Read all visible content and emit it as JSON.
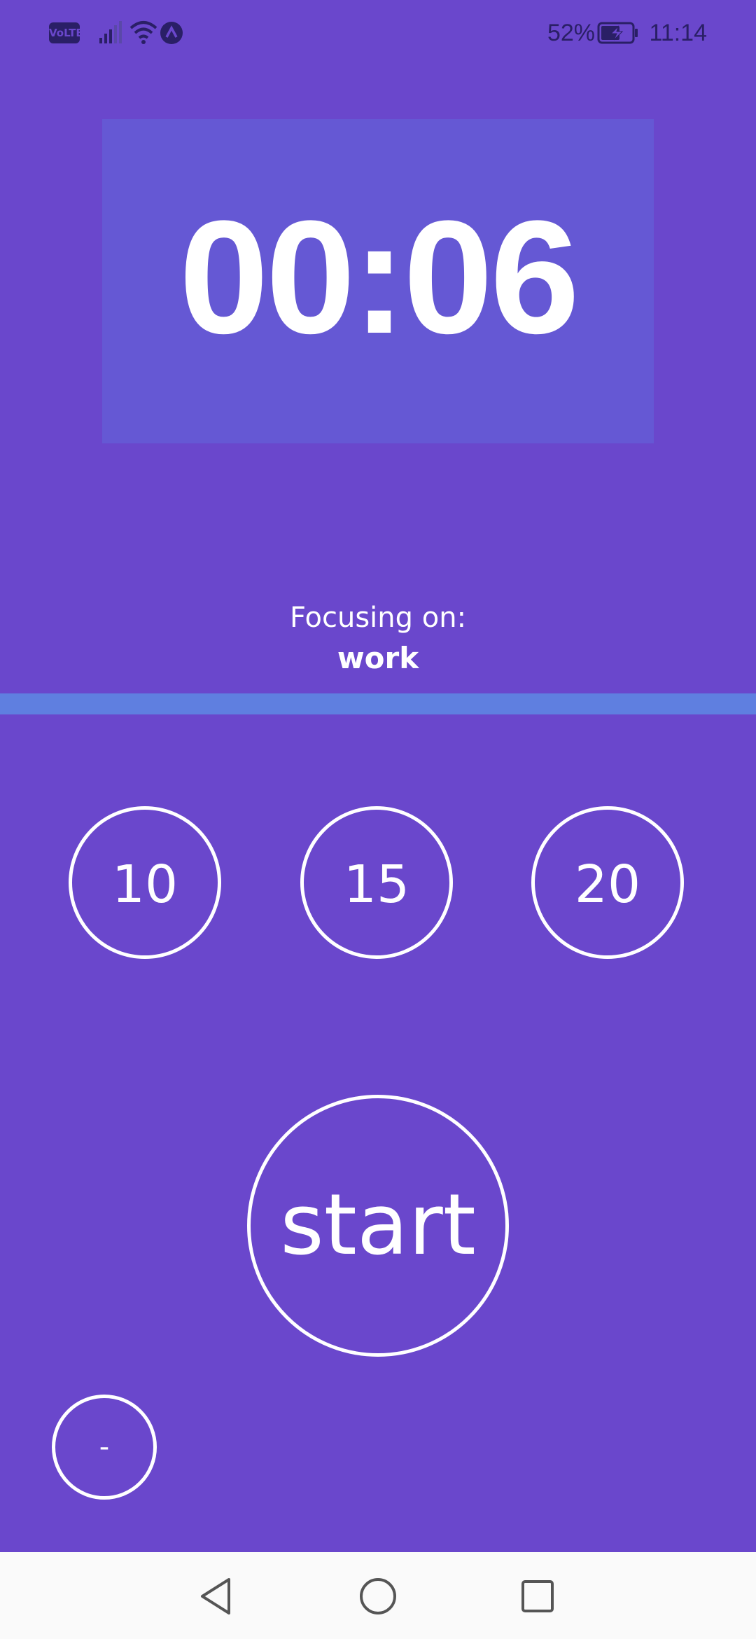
{
  "status_bar": {
    "volte": "VoLTE",
    "battery_percent": "52%",
    "time": "11:14"
  },
  "timer": {
    "display": "00:06"
  },
  "focus": {
    "label": "Focusing on:",
    "value": "work"
  },
  "progress": {
    "fraction": 0.0
  },
  "presets": [
    {
      "label": "10"
    },
    {
      "label": "15"
    },
    {
      "label": "20"
    }
  ],
  "start_button": {
    "label": "start"
  },
  "minus_button": {
    "label": "-"
  },
  "colors": {
    "background": "#6a47cc",
    "timer_box": "#6558d4",
    "progress": "#5f7fe0",
    "foreground": "#ffffff",
    "nav_bar": "#fafafa"
  },
  "nav": {
    "back_icon": "triangle-back-icon",
    "home_icon": "circle-home-icon",
    "recents_icon": "square-recents-icon"
  }
}
